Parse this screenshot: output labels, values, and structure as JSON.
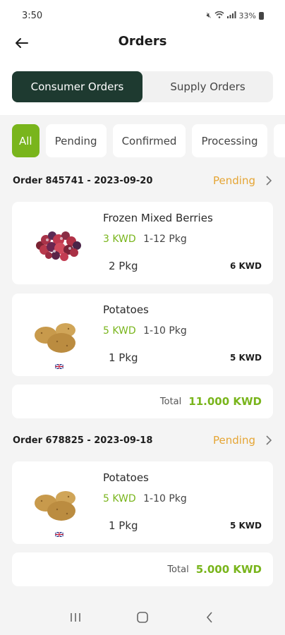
{
  "status_bar": {
    "time": "3:50",
    "battery": "33%"
  },
  "header": {
    "title": "Orders"
  },
  "tabs": [
    {
      "label": "Consumer Orders",
      "active": true
    },
    {
      "label": "Supply Orders",
      "active": false
    }
  ],
  "filters": [
    {
      "label": "All",
      "active": true
    },
    {
      "label": "Pending"
    },
    {
      "label": "Confirmed"
    },
    {
      "label": "Processing"
    }
  ],
  "orders": [
    {
      "title": "Order 845741 - 2023-09-20",
      "status": "Pending",
      "items": [
        {
          "name": "Frozen Mixed Berries",
          "price": "3 KWD",
          "range": "1-12 Pkg",
          "qty": "2 Pkg",
          "line_total": "6 KWD",
          "image": "mixed-berries"
        },
        {
          "name": "Potatoes",
          "price": "5 KWD",
          "range": "1-10 Pkg",
          "qty": "1 Pkg",
          "line_total": "5 KWD",
          "image": "potatoes"
        }
      ],
      "total_label": "Total",
      "total_value": "11.000 KWD"
    },
    {
      "title": "Order 678825 - 2023-09-18",
      "status": "Pending",
      "items": [
        {
          "name": "Potatoes",
          "price": "5 KWD",
          "range": "1-10 Pkg",
          "qty": "1 Pkg",
          "line_total": "5 KWD",
          "image": "potatoes"
        }
      ],
      "total_label": "Total",
      "total_value": "5.000 KWD"
    }
  ],
  "colors": {
    "accent": "#79b51c",
    "dark": "#1e3a30",
    "pending": "#e5a534"
  }
}
